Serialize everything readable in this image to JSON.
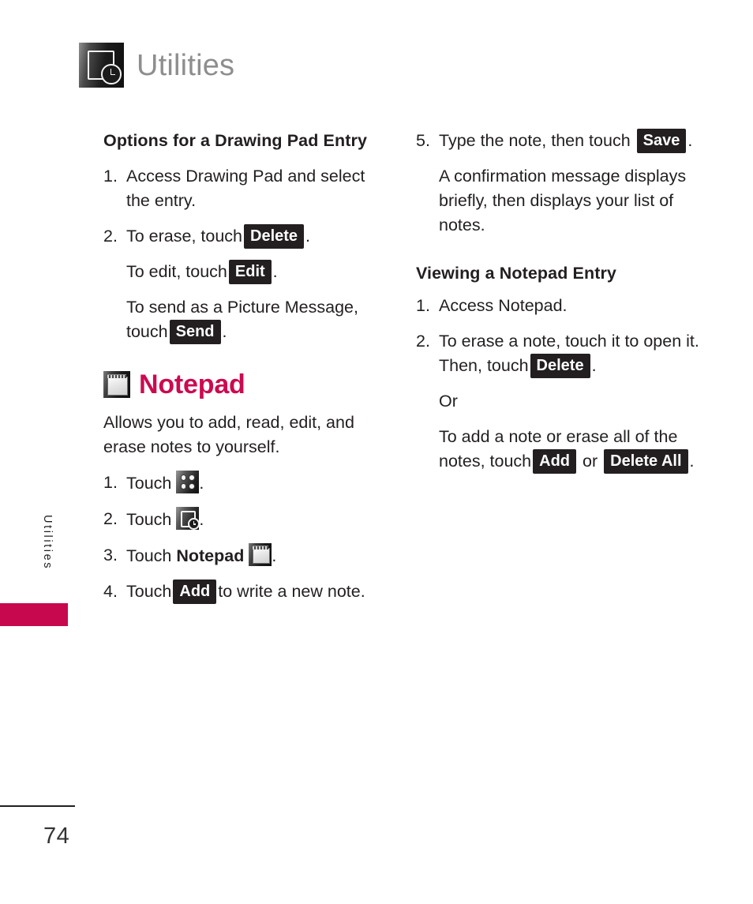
{
  "header": {
    "title": "Utilities",
    "icon": "utilities-clock-icon"
  },
  "side_label": {
    "text": "Utilities",
    "tab_color": "#c8084e"
  },
  "footer": {
    "page_number": "74"
  },
  "theme": {
    "accent": "#cc0a50",
    "key_bg": "#231f20",
    "header_gray": "#8e8e8e",
    "body_text": "#231f20"
  },
  "left_column": {
    "section_heading": "Options for a Drawing Pad Entry",
    "steps": [
      {
        "num": "1.",
        "text": "Access Drawing Pad and select the entry."
      }
    ],
    "step2": {
      "num": "2.",
      "lead": "To erase, touch",
      "key": "Delete",
      "period": ".",
      "sub1_lead": "To edit, touch",
      "sub1_key": "Edit",
      "sub1_period": ".",
      "sub2_lead": "To send as a Picture Message, touch",
      "sub2_key": "Send",
      "sub2_period": "."
    },
    "notepad": {
      "title": "Notepad",
      "icon": "notepad-icon",
      "description": "Allows you to add, read, edit, and erase notes to yourself.",
      "steps": [
        {
          "num": "1.",
          "lead": "Touch",
          "icon": "grid-menu-icon",
          "trail": "."
        },
        {
          "num": "2.",
          "lead": "Touch",
          "icon": "utilities-clock-icon",
          "trail": "."
        },
        {
          "num": "3.",
          "lead": "Touch",
          "bold": "Notepad",
          "icon": "notepad-icon",
          "trail": "."
        },
        {
          "num": "4.",
          "lead": "Touch",
          "key": "Add",
          "trail": "to write a new note."
        }
      ]
    }
  },
  "right_column": {
    "step5": {
      "num": "5.",
      "lead": "Type the note, then touch",
      "key": "Save",
      "period": ".",
      "note": "A confirmation message displays briefly, then displays your list of notes."
    },
    "section_heading": "Viewing a Notepad Entry",
    "steps": [
      {
        "num": "1.",
        "text": "Access Notepad."
      }
    ],
    "step2": {
      "num": "2.",
      "lead": "To erase a note, touch it to open it. Then, touch",
      "key": "Delete",
      "period": ".",
      "or": "Or",
      "alt_lead": "To add a note or erase all of the notes, touch",
      "alt_key1": "Add",
      "alt_join": "or",
      "alt_key2": "Delete All",
      "alt_period": "."
    }
  }
}
